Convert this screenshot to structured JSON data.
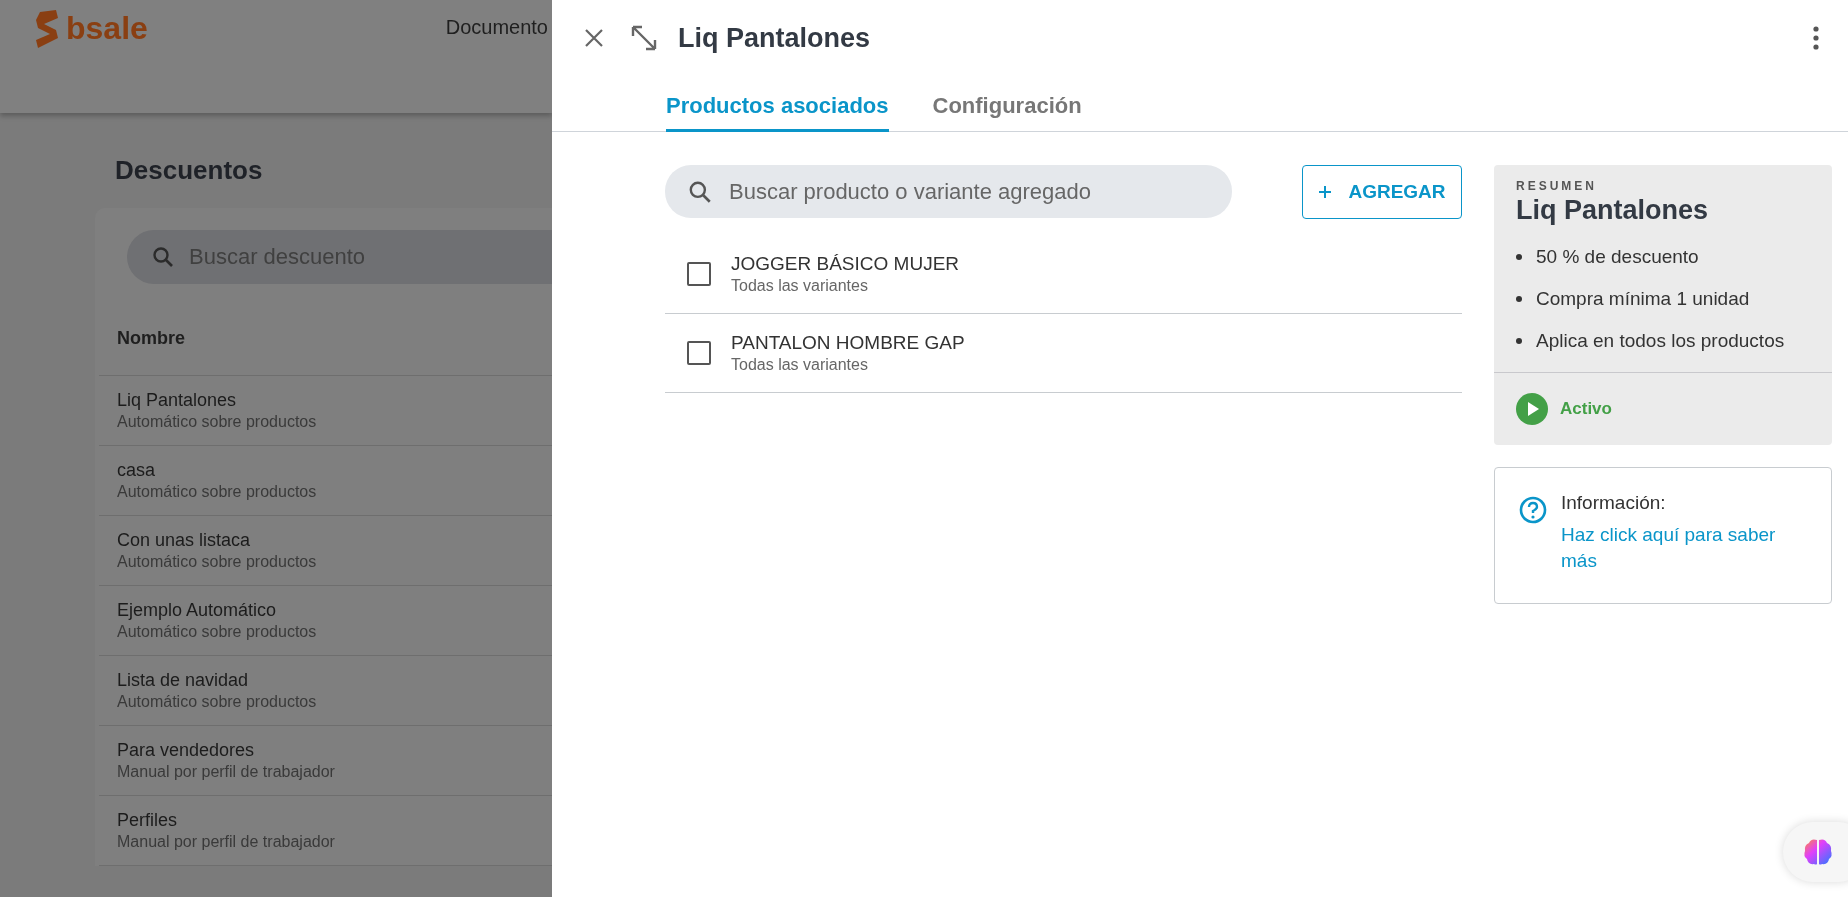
{
  "app": {
    "brand": "bsale",
    "nav_item": "Documento"
  },
  "page": {
    "title": "Descuentos",
    "search": {
      "placeholder": "Buscar descuento"
    },
    "column": "Nombre",
    "rows": [
      {
        "name": "Liq Pantalones",
        "type": "Automático sobre productos"
      },
      {
        "name": "casa",
        "type": "Automático sobre productos"
      },
      {
        "name": "Con unas listaca",
        "type": "Automático sobre productos"
      },
      {
        "name": "Ejemplo Automático",
        "type": "Automático sobre productos"
      },
      {
        "name": "Lista de navidad",
        "type": "Automático sobre productos"
      },
      {
        "name": "Para vendedores",
        "type": "Manual por perfil de trabajador"
      },
      {
        "name": "Perfiles",
        "type": "Manual por perfil de trabajador"
      }
    ]
  },
  "drawer": {
    "title": "Liq Pantalones",
    "tabs": [
      {
        "label": "Productos asociados",
        "selected": true
      },
      {
        "label": "Configuración",
        "selected": false
      }
    ],
    "search": {
      "placeholder": "Buscar producto o variante agregado"
    },
    "add_button": "AGREGAR",
    "products": [
      {
        "name": "JOGGER BÁSICO MUJER",
        "variants": "Todas las variantes",
        "checked": false
      },
      {
        "name": "PANTALON HOMBRE GAP",
        "variants": "Todas las variantes",
        "checked": false
      }
    ],
    "summary": {
      "label": "RESUMEN",
      "title": "Liq Pantalones",
      "items": [
        "50 % de descuento",
        "Compra mínima 1 unidad",
        "Aplica en todos los productos"
      ],
      "status": {
        "label": "Activo",
        "active": true
      }
    },
    "info": {
      "title": "Información:",
      "link": "Haz click aquí para saber más"
    }
  }
}
